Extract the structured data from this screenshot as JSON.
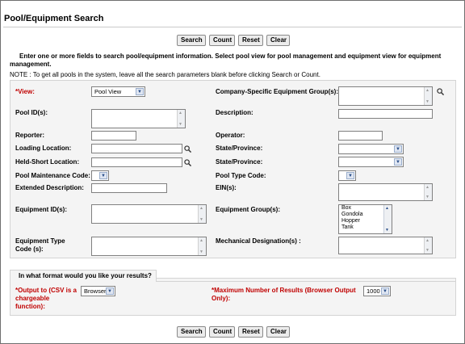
{
  "page": {
    "title": "Pool/Equipment Search"
  },
  "buttons": {
    "search": "Search",
    "count": "Count",
    "reset": "Reset",
    "clear": "Clear"
  },
  "intro": "Enter one or more fields to search pool/equipment information. Select pool view for pool management and equipment view for equipment management.",
  "note": "NOTE : To get all pools in the system, leave all the search parameters blank before clicking Search or Count.",
  "form": {
    "view": {
      "label": "*View:",
      "value": "Pool View"
    },
    "company_group": {
      "label": "Company-Specific Equipment Group(s):",
      "value": ""
    },
    "pool_ids": {
      "label": "Pool ID(s):",
      "value": ""
    },
    "description": {
      "label": "Description:",
      "value": ""
    },
    "reporter": {
      "label": "Reporter:",
      "value": ""
    },
    "operator": {
      "label": "Operator:",
      "value": ""
    },
    "loading_location": {
      "label": "Loading Location:",
      "value": ""
    },
    "state1": {
      "label": "State/Province:",
      "value": ""
    },
    "held_short": {
      "label": "Held-Short Location:",
      "value": ""
    },
    "state2": {
      "label": "State/Province:",
      "value": ""
    },
    "pool_maint": {
      "label": "Pool Maintenance Code:",
      "value": ""
    },
    "pool_type": {
      "label": "Pool Type Code:",
      "value": ""
    },
    "ext_desc": {
      "label": "Extended Description:",
      "value": ""
    },
    "ein": {
      "label": "EIN(s):",
      "value": ""
    },
    "equip_ids": {
      "label": "Equipment ID(s):",
      "value": ""
    },
    "equip_groups": {
      "label": "Equipment Group(s):",
      "options": [
        "Box",
        "Gondola",
        "Hopper",
        "Tank"
      ]
    },
    "equip_type": {
      "label": "Equipment Type Code (s):",
      "value": ""
    },
    "mech_desig": {
      "label": "Mechanical Designation(s) :",
      "value": ""
    }
  },
  "format": {
    "heading": "In what format would you like your results?",
    "output_label": "*Output to (CSV is a chargeable function):",
    "output_value": "Browser",
    "max_label": "*Maximum Number of Results (Browser Output Only):",
    "max_value": "1000"
  }
}
